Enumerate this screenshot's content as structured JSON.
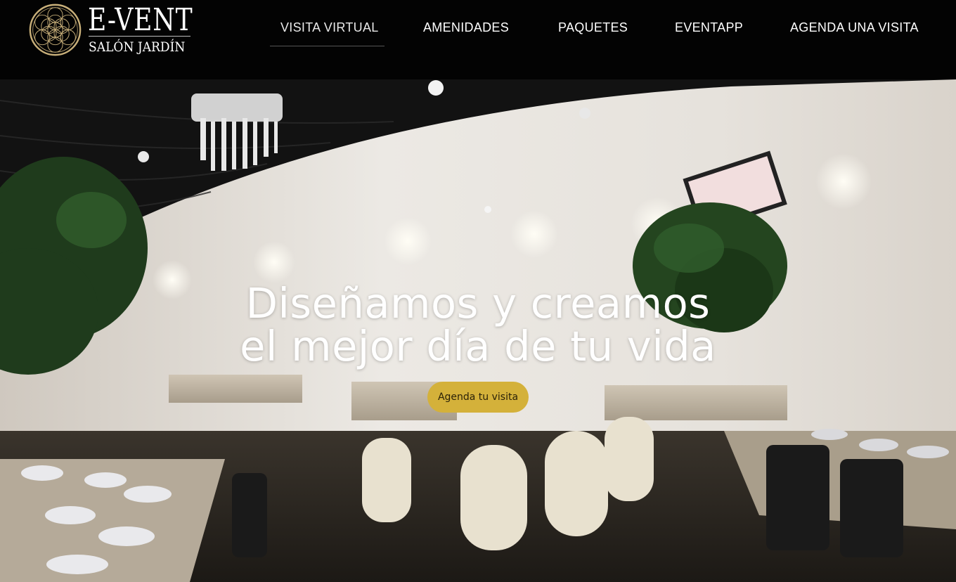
{
  "brand": {
    "title": "E-VENT",
    "subtitle": "SALÓN JARDÍN",
    "accent_color": "#c9b07a"
  },
  "nav": {
    "items": [
      {
        "label": "VISITA VIRTUAL",
        "active": true
      },
      {
        "label": "AMENIDADES",
        "active": false
      },
      {
        "label": "PAQUETES",
        "active": false
      },
      {
        "label": "EVENTAPP",
        "active": false
      },
      {
        "label": "AGENDA UNA VISITA",
        "active": false
      }
    ]
  },
  "hero": {
    "title_line1": "Diseñamos y creamos",
    "title_line2": "el mejor día de tu vida",
    "cta_label": "Agenda tu visita",
    "cta_color": "#d4b13a",
    "background_icon": "event-venue-photo"
  }
}
